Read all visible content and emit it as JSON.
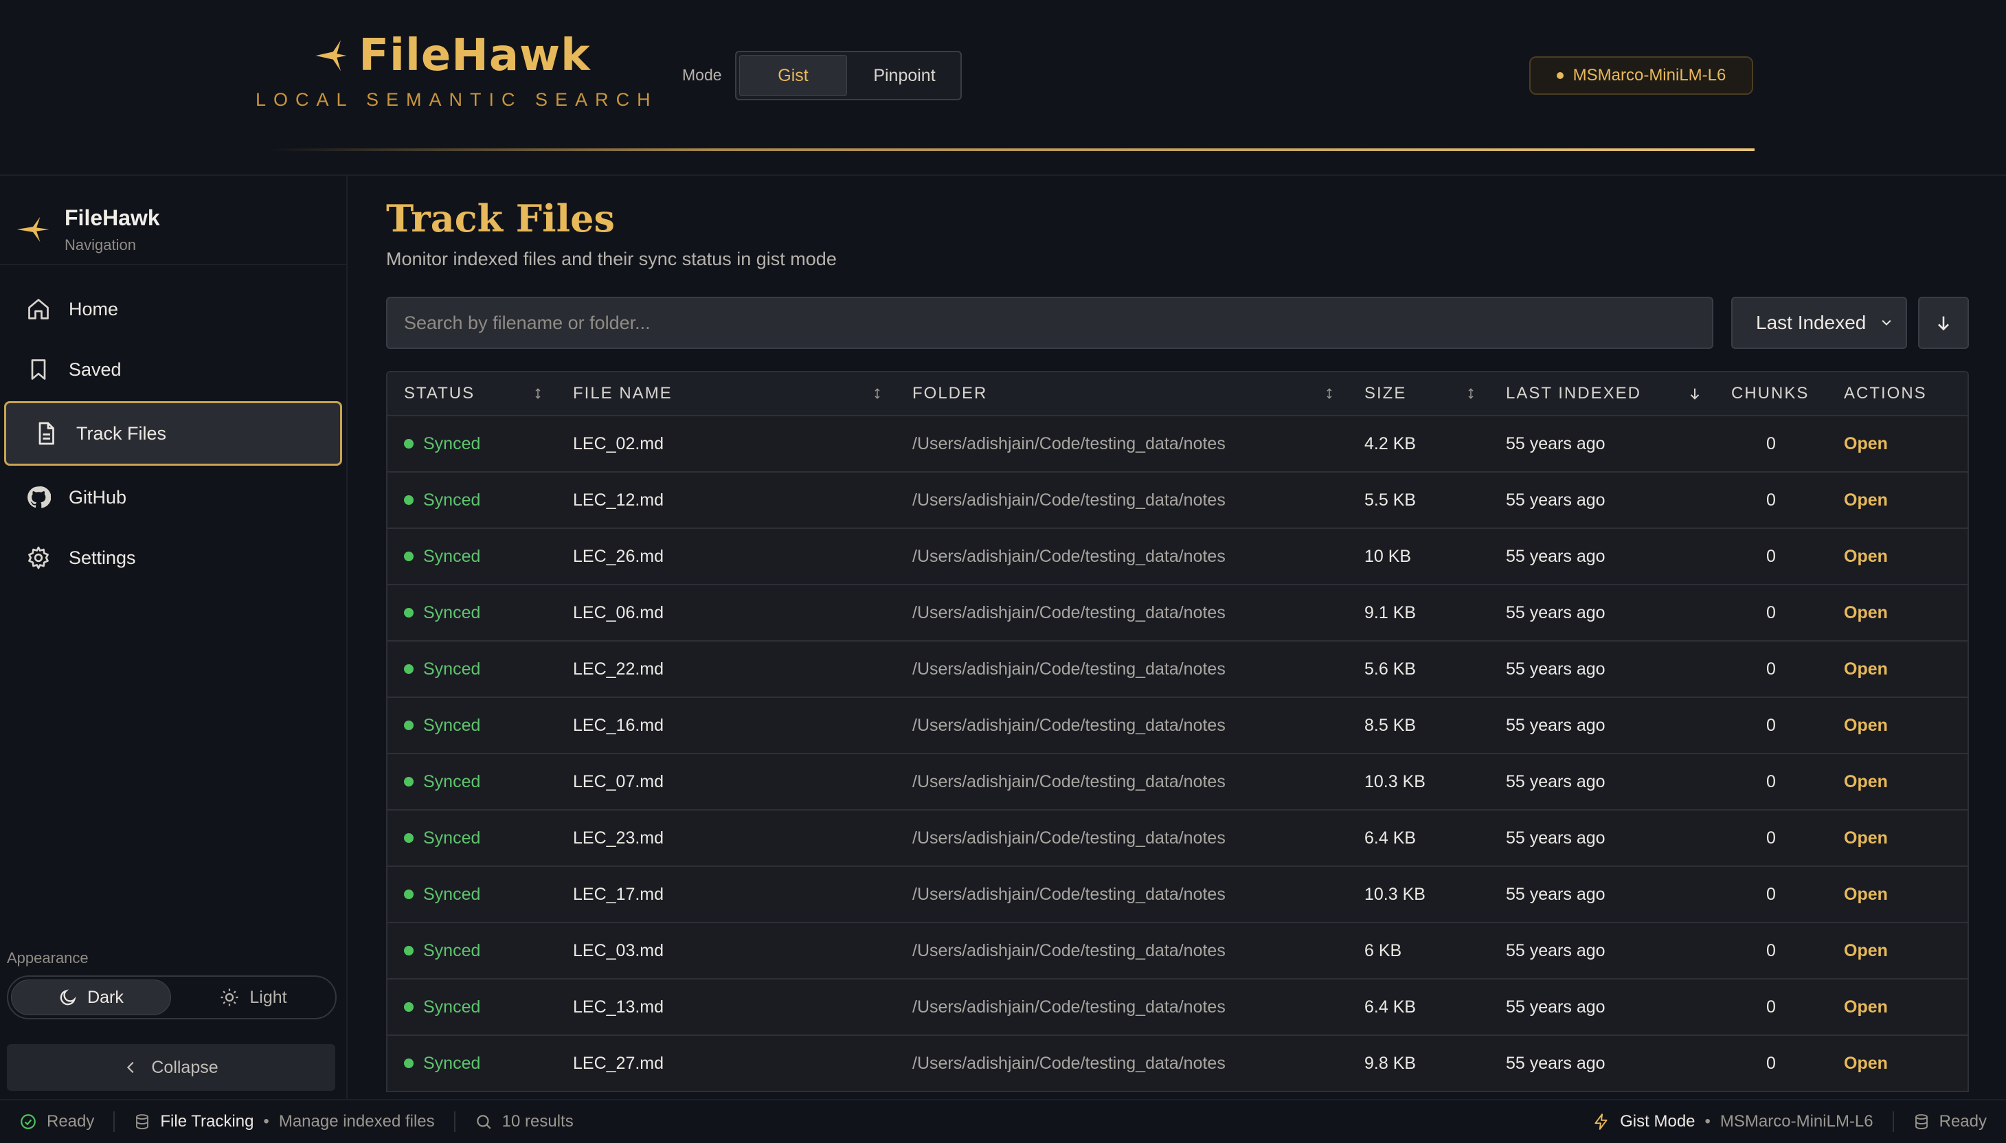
{
  "header": {
    "title": "FileHawk",
    "subtitle": "LOCAL SEMANTIC SEARCH",
    "mode_label": "Mode",
    "modes": [
      "Gist",
      "Pinpoint"
    ],
    "active_mode": "Gist",
    "model": "MSMarco-MiniLM-L6",
    "accent_color": "#e8b95a"
  },
  "sidebar": {
    "title": "FileHawk",
    "subtitle": "Navigation",
    "items": [
      {
        "label": "Home",
        "icon": "home-icon"
      },
      {
        "label": "Saved",
        "icon": "bookmark-icon"
      },
      {
        "label": "Track Files",
        "icon": "document-icon"
      },
      {
        "label": "GitHub",
        "icon": "github-icon"
      },
      {
        "label": "Settings",
        "icon": "gear-icon"
      }
    ],
    "active_item": "Track Files",
    "appearance_label": "Appearance",
    "themes": [
      "Dark",
      "Light"
    ],
    "active_theme": "Dark",
    "collapse_label": "Collapse"
  },
  "main": {
    "title": "Track Files",
    "subtitle": "Monitor indexed files and their sync status in gist mode",
    "search_placeholder": "Search by filename or folder...",
    "sort_value": "Last Indexed",
    "columns": [
      "STATUS",
      "FILE NAME",
      "FOLDER",
      "SIZE",
      "LAST INDEXED",
      "CHUNKS",
      "ACTIONS"
    ],
    "rows": [
      {
        "status": "Synced",
        "name": "LEC_02.md",
        "folder": "/Users/adishjain/Code/testing_data/notes",
        "size": "4.2 KB",
        "indexed": "55 years ago",
        "chunks": "0",
        "action": "Open"
      },
      {
        "status": "Synced",
        "name": "LEC_12.md",
        "folder": "/Users/adishjain/Code/testing_data/notes",
        "size": "5.5 KB",
        "indexed": "55 years ago",
        "chunks": "0",
        "action": "Open"
      },
      {
        "status": "Synced",
        "name": "LEC_26.md",
        "folder": "/Users/adishjain/Code/testing_data/notes",
        "size": "10 KB",
        "indexed": "55 years ago",
        "chunks": "0",
        "action": "Open"
      },
      {
        "status": "Synced",
        "name": "LEC_06.md",
        "folder": "/Users/adishjain/Code/testing_data/notes",
        "size": "9.1 KB",
        "indexed": "55 years ago",
        "chunks": "0",
        "action": "Open"
      },
      {
        "status": "Synced",
        "name": "LEC_22.md",
        "folder": "/Users/adishjain/Code/testing_data/notes",
        "size": "5.6 KB",
        "indexed": "55 years ago",
        "chunks": "0",
        "action": "Open"
      },
      {
        "status": "Synced",
        "name": "LEC_16.md",
        "folder": "/Users/adishjain/Code/testing_data/notes",
        "size": "8.5 KB",
        "indexed": "55 years ago",
        "chunks": "0",
        "action": "Open"
      },
      {
        "status": "Synced",
        "name": "LEC_07.md",
        "folder": "/Users/adishjain/Code/testing_data/notes",
        "size": "10.3 KB",
        "indexed": "55 years ago",
        "chunks": "0",
        "action": "Open"
      },
      {
        "status": "Synced",
        "name": "LEC_23.md",
        "folder": "/Users/adishjain/Code/testing_data/notes",
        "size": "6.4 KB",
        "indexed": "55 years ago",
        "chunks": "0",
        "action": "Open"
      },
      {
        "status": "Synced",
        "name": "LEC_17.md",
        "folder": "/Users/adishjain/Code/testing_data/notes",
        "size": "10.3 KB",
        "indexed": "55 years ago",
        "chunks": "0",
        "action": "Open"
      },
      {
        "status": "Synced",
        "name": "LEC_03.md",
        "folder": "/Users/adishjain/Code/testing_data/notes",
        "size": "6 KB",
        "indexed": "55 years ago",
        "chunks": "0",
        "action": "Open"
      },
      {
        "status": "Synced",
        "name": "LEC_13.md",
        "folder": "/Users/adishjain/Code/testing_data/notes",
        "size": "6.4 KB",
        "indexed": "55 years ago",
        "chunks": "0",
        "action": "Open"
      },
      {
        "status": "Synced",
        "name": "LEC_27.md",
        "folder": "/Users/adishjain/Code/testing_data/notes",
        "size": "9.8 KB",
        "indexed": "55 years ago",
        "chunks": "0",
        "action": "Open"
      }
    ],
    "status_color": "#4fc45e"
  },
  "statusbar": {
    "ready": "Ready",
    "section": "File Tracking",
    "section_desc": "Manage indexed files",
    "results": "10 results",
    "mode": "Gist Mode",
    "model": "MSMarco-MiniLM-L6",
    "db_status": "Ready"
  }
}
